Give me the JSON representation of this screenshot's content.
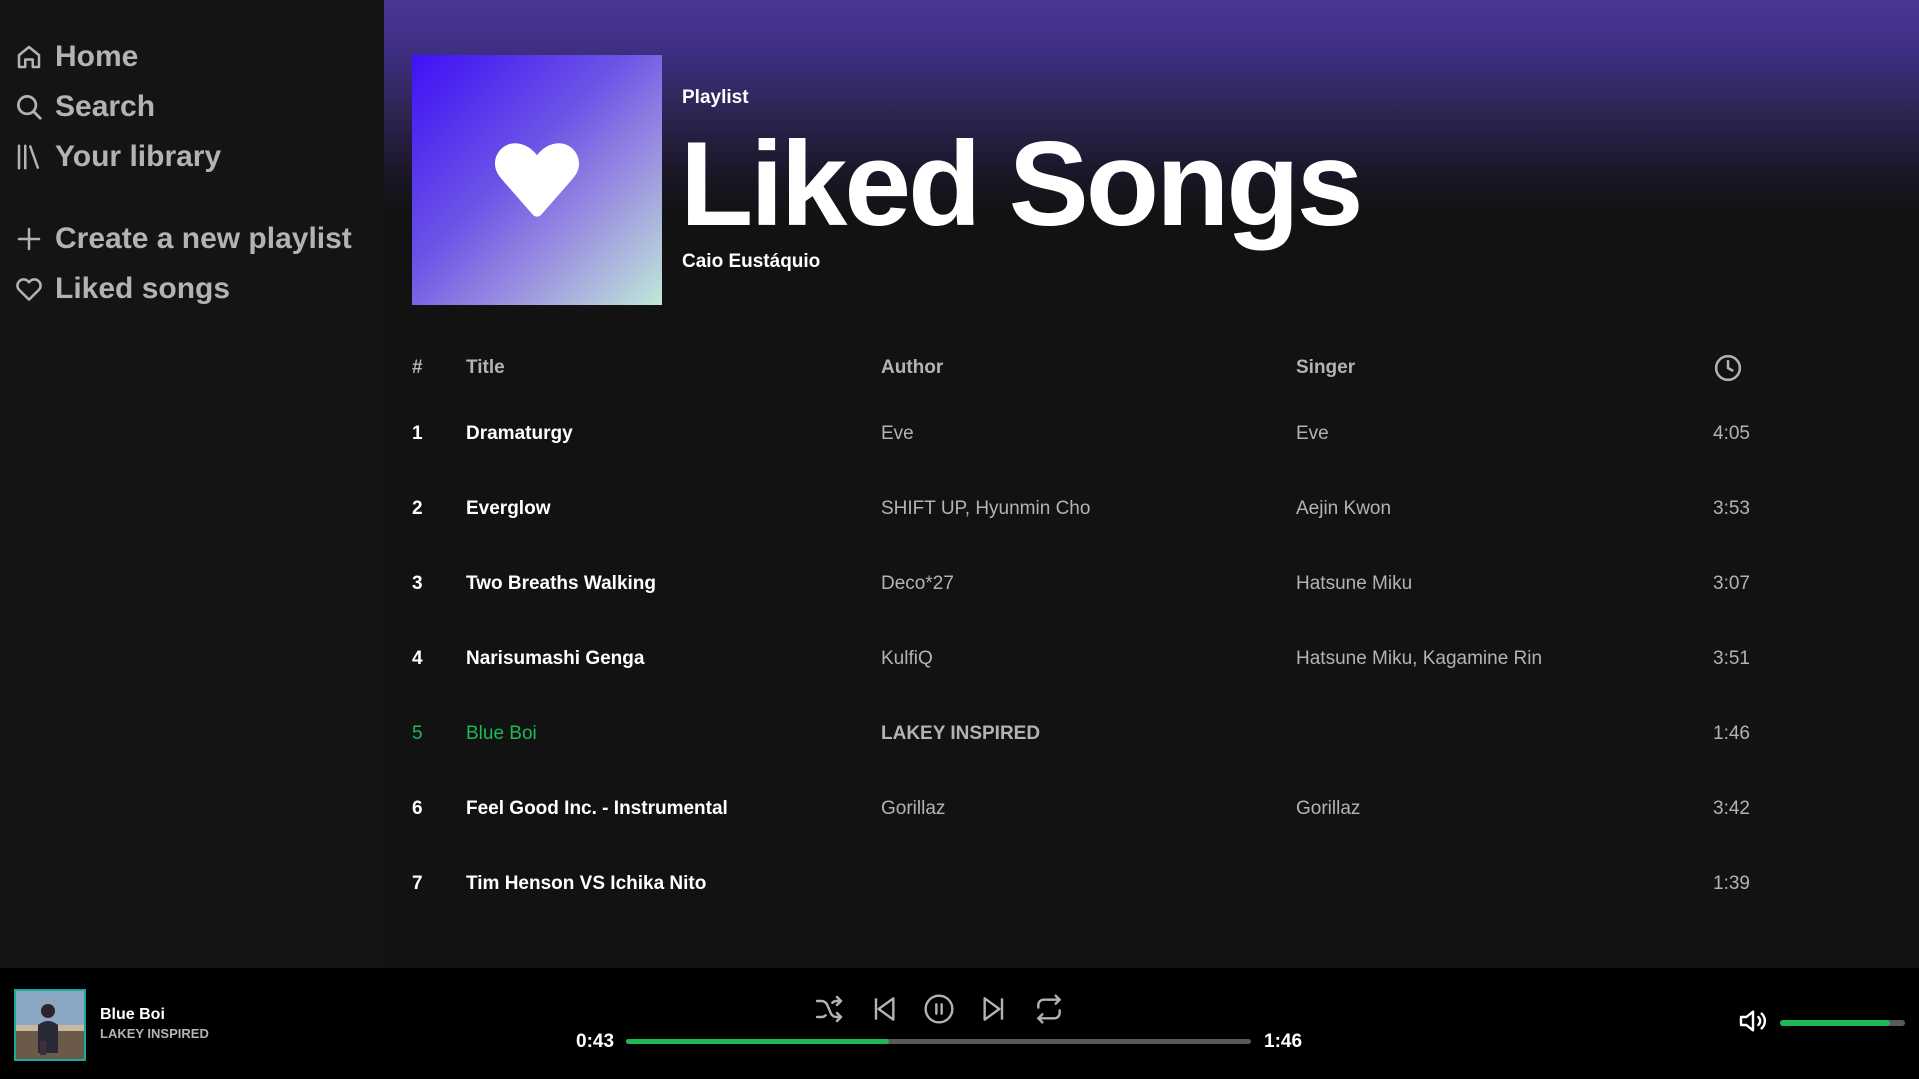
{
  "sidebar": {
    "items": [
      {
        "label": "Home",
        "icon": "home-icon"
      },
      {
        "label": "Search",
        "icon": "search-icon"
      },
      {
        "label": "Your library",
        "icon": "library-icon"
      }
    ],
    "playlist_items": [
      {
        "label": "Create a new playlist",
        "icon": "plus-icon"
      },
      {
        "label": "Liked songs",
        "icon": "heart-icon"
      }
    ]
  },
  "playlist": {
    "type": "Playlist",
    "title": "Liked Songs",
    "owner": "Caio Eustáquio",
    "cover_icon": "heart-icon"
  },
  "table": {
    "headers": {
      "num": "#",
      "title": "Title",
      "author": "Author",
      "singer": "Singer",
      "duration_icon": "clock-icon"
    },
    "rows": [
      {
        "num": "1",
        "title": "Dramaturgy",
        "author": "Eve",
        "singer": "Eve",
        "duration": "4:05"
      },
      {
        "num": "2",
        "title": "Everglow",
        "author": "SHIFT UP, Hyunmin Cho",
        "singer": "Aejin Kwon",
        "duration": "3:53"
      },
      {
        "num": "3",
        "title": "Two Breaths Walking",
        "author": "Deco*27",
        "singer": "Hatsune Miku",
        "duration": "3:07"
      },
      {
        "num": "4",
        "title": "Narisumashi Genga",
        "author": "KulfiQ",
        "singer": "Hatsune Miku, Kagamine Rin",
        "duration": "3:51"
      },
      {
        "num": "5",
        "title": "Blue Boi",
        "author": "LAKEY INSPIRED",
        "singer": "",
        "duration": "1:46"
      },
      {
        "num": "6",
        "title": "Feel Good Inc. - Instrumental",
        "author": "Gorillaz",
        "singer": "Gorillaz",
        "duration": "3:42"
      },
      {
        "num": "7",
        "title": "Tim Henson VS Ichika Nito",
        "author": "",
        "singer": "",
        "duration": "1:39"
      }
    ],
    "active_index": 4
  },
  "player": {
    "title": "Blue Boi",
    "artist": "LAKEY INSPIRED",
    "current_time": "0:43",
    "total_time": "1:46",
    "progress": 0.42,
    "volume": 0.88,
    "controls": [
      "shuffle-icon",
      "previous-icon",
      "pause-icon",
      "next-icon",
      "repeat-icon"
    ]
  },
  "colors": {
    "accent": "#1db954",
    "background": "#121212",
    "sidebar": "#141414",
    "header_gradient": "#4a3592"
  }
}
